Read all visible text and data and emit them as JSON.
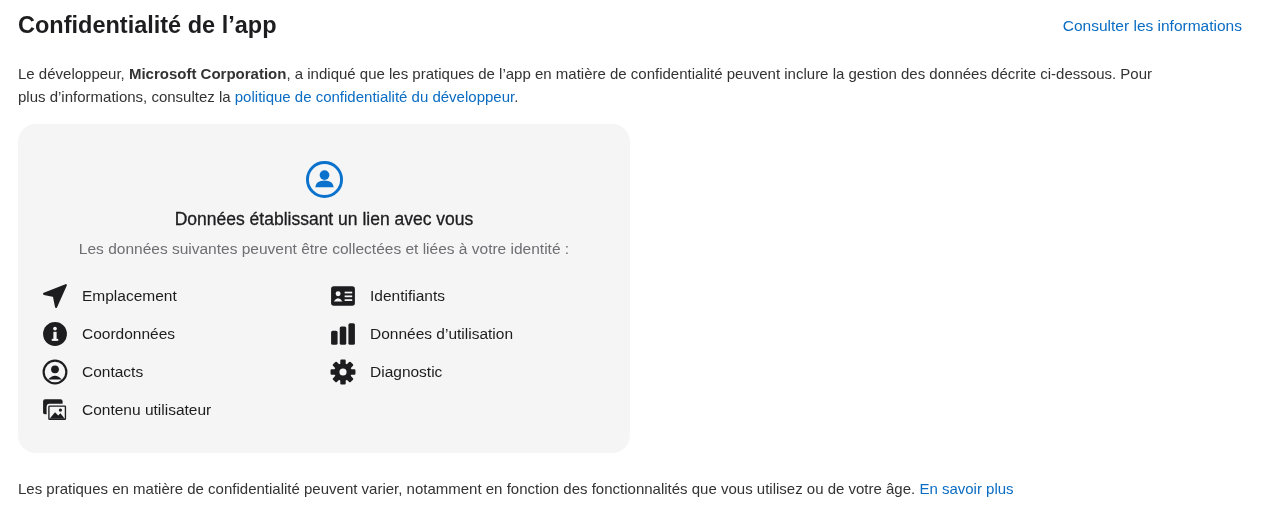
{
  "title": "Confidentialité de l’app",
  "header_link": "Consulter les informations",
  "intro": {
    "text": "Le développeur, **Microsoft Corporation**, a indiqué que les pratiques de l’app en matière de confidentialité peuvent inclure la gestion des données décrite ci-dessous. Pour plus d’informations, consultez la",
    "link": "politique de confidentialité du développeur",
    "after": "."
  },
  "card": {
    "heading": "Données établissant un lien avec vous",
    "subtitle": "Les données suivantes peuvent être collectées et liées à votre identité :",
    "columns": [
      [
        {
          "kind": "location",
          "label": "Emplacement"
        },
        {
          "kind": "info",
          "label": "Coordonnées"
        },
        {
          "kind": "contact",
          "label": "Contacts"
        },
        {
          "kind": "photos",
          "label": "Contenu utilisateur"
        }
      ],
      [
        {
          "kind": "idcard",
          "label": "Identifiants"
        },
        {
          "kind": "bars",
          "label": "Données d’utilisation"
        },
        {
          "kind": "gear",
          "label": "Diagnostic"
        }
      ]
    ]
  },
  "footer": {
    "text": "Les pratiques en matière de confidentialité peuvent varier, notamment en fonction des fonctionnalités que vous utilisez ou de votre âge.",
    "link": "En savoir plus"
  }
}
